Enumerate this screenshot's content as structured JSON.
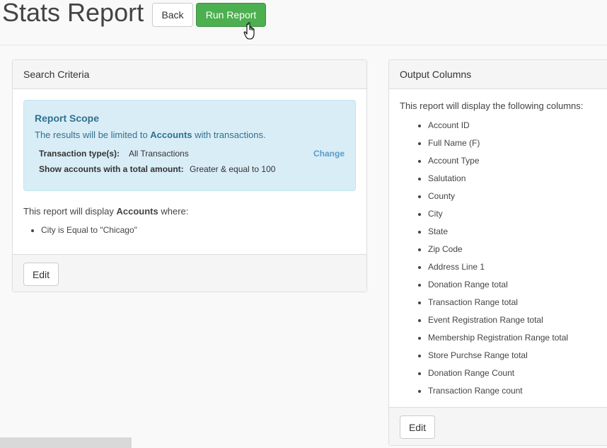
{
  "header": {
    "title": "Stats Report",
    "back_label": "Back",
    "run_label": "Run Report"
  },
  "search_criteria": {
    "title": "Search Criteria",
    "scope": {
      "title": "Report Scope",
      "text_pre": "The results will be limited to ",
      "text_entity": "Accounts",
      "text_post": " with transactions.",
      "transaction_label": "Transaction type(s):",
      "transaction_value": "All Transactions",
      "amount_label": "Show accounts with a total amount:",
      "amount_value": "Greater & equal to 100",
      "change_label": "Change"
    },
    "display_pre": "This report will display ",
    "display_entity": "Accounts",
    "display_post": " where:",
    "conditions": [
      "City is Equal to \"Chicago\""
    ],
    "edit_label": "Edit"
  },
  "output_columns": {
    "title": "Output Columns",
    "intro": "This report will display the following columns:",
    "columns": [
      "Account ID",
      "Full Name (F)",
      "Account Type",
      "Salutation",
      "County",
      "City",
      "State",
      "Zip Code",
      "Address Line 1",
      "Donation Range total",
      "Transaction Range total",
      "Event Registration Range total",
      "Membership Registration Range total",
      "Store Purchse Range total",
      "Donation Range Count",
      "Transaction Range count"
    ],
    "edit_label": "Edit"
  }
}
